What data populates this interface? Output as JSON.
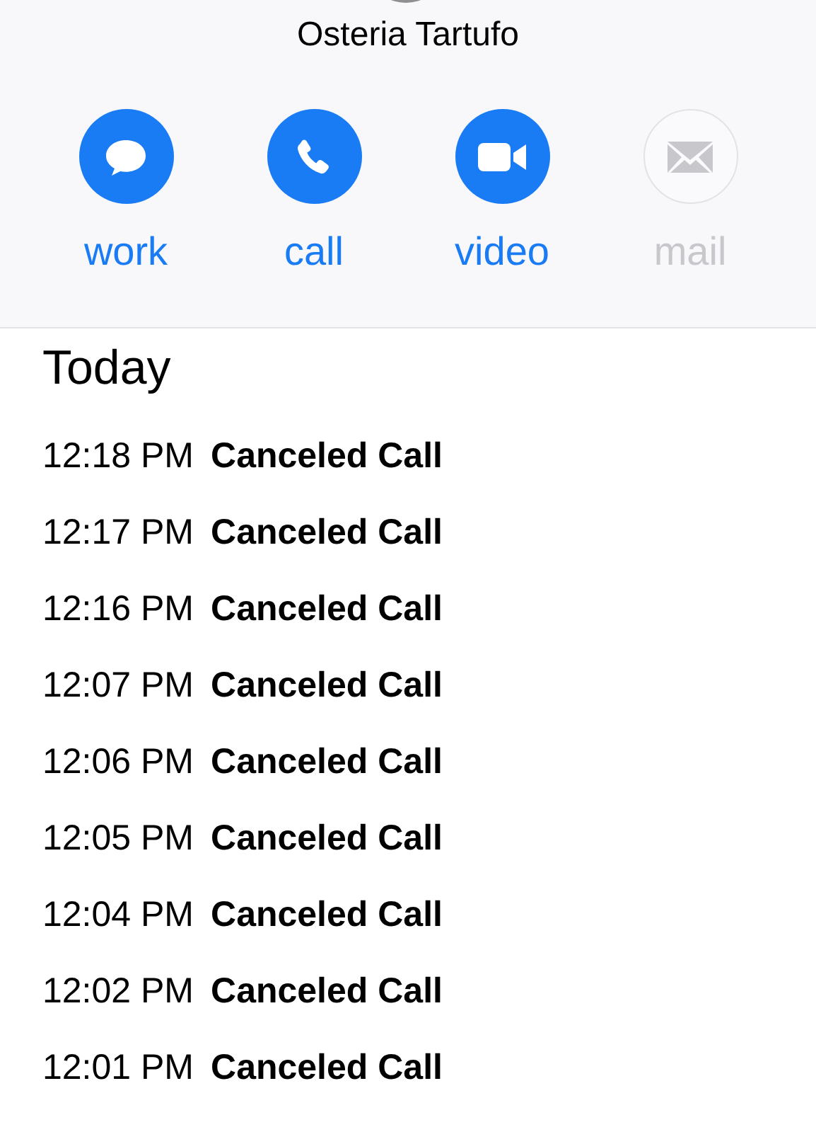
{
  "contact": {
    "name": "Osteria Tartufo"
  },
  "actions": [
    {
      "kind": "message",
      "label": "work",
      "disabled": false
    },
    {
      "kind": "phone",
      "label": "call",
      "disabled": false
    },
    {
      "kind": "video",
      "label": "video",
      "disabled": false
    },
    {
      "kind": "mail",
      "label": "mail",
      "disabled": true
    }
  ],
  "history": {
    "title": "Today",
    "rows": [
      {
        "time": "12:18 PM",
        "type": "Canceled Call"
      },
      {
        "time": "12:17 PM",
        "type": "Canceled Call"
      },
      {
        "time": "12:16 PM",
        "type": "Canceled Call"
      },
      {
        "time": "12:07 PM",
        "type": "Canceled Call"
      },
      {
        "time": "12:06 PM",
        "type": "Canceled Call"
      },
      {
        "time": "12:05 PM",
        "type": "Canceled Call"
      },
      {
        "time": "12:04 PM",
        "type": "Canceled Call"
      },
      {
        "time": "12:02 PM",
        "type": "Canceled Call"
      },
      {
        "time": "12:01 PM",
        "type": "Canceled Call"
      }
    ]
  }
}
